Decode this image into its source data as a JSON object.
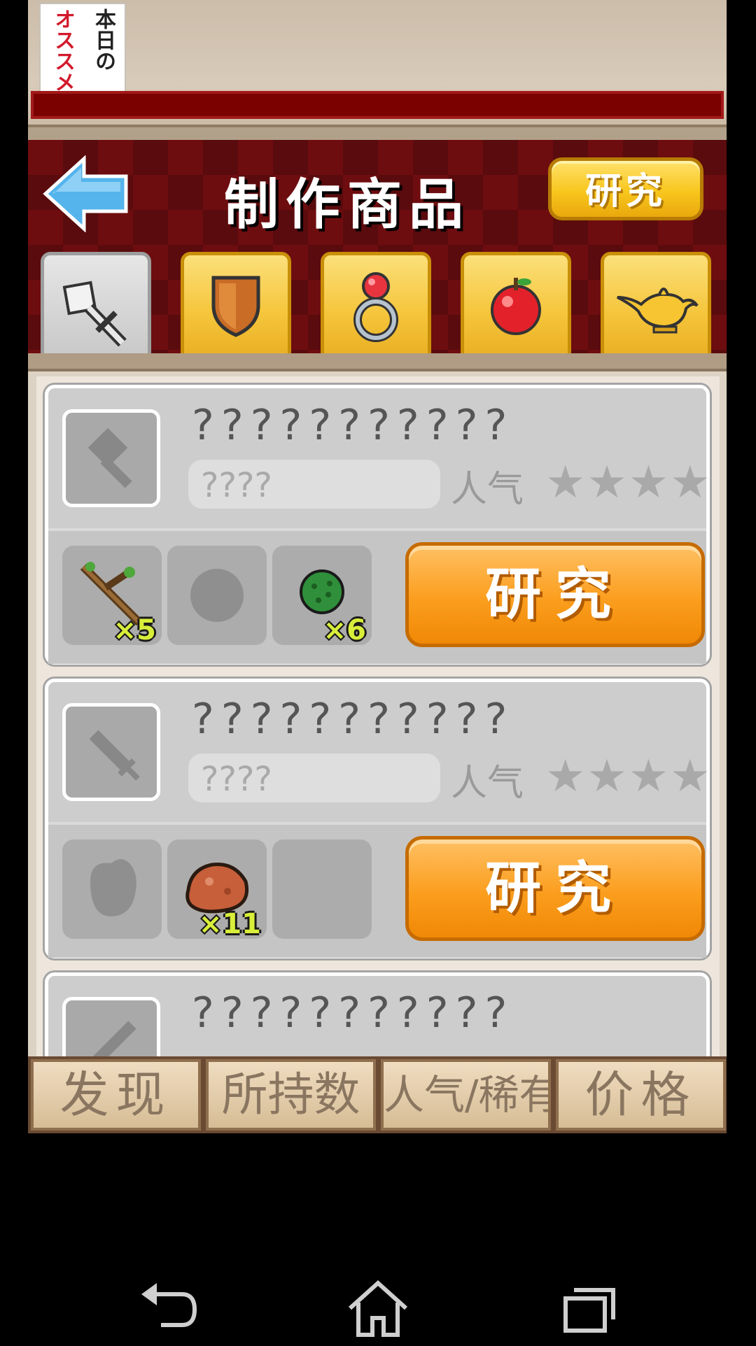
{
  "banner": {
    "logo_col1": "本日の",
    "logo_col2": "オススメ"
  },
  "header": {
    "title": "制作商品",
    "research_label": "研究"
  },
  "tabs": [
    {
      "name": "weapon",
      "icon": "sword-icon",
      "selected": true
    },
    {
      "name": "armor",
      "icon": "shield-icon",
      "selected": false
    },
    {
      "name": "accessory",
      "icon": "ring-icon",
      "selected": false
    },
    {
      "name": "food",
      "icon": "apple-icon",
      "selected": false
    },
    {
      "name": "magic",
      "icon": "magic-lamp-icon",
      "selected": false
    }
  ],
  "cards": [
    {
      "name": "???????????",
      "tag": "????",
      "popularity_label": "人气",
      "stars": "★★★★",
      "thumb_icon": "hammer-silhouette-icon",
      "materials": [
        {
          "icon": "branch-icon",
          "qty": "×5"
        },
        {
          "icon": "unknown-material-icon",
          "qty": ""
        },
        {
          "icon": "green-ball-icon",
          "qty": "×6"
        }
      ],
      "button_label": "研究"
    },
    {
      "name": "???????????",
      "tag": "????",
      "popularity_label": "人气",
      "stars": "★★★★",
      "thumb_icon": "sword-silhouette-icon",
      "materials": [
        {
          "icon": "unknown-material-icon",
          "qty": ""
        },
        {
          "icon": "ore-rock-icon",
          "qty": "×11"
        },
        {
          "icon": "empty-slot",
          "qty": ""
        }
      ],
      "button_label": "研究"
    },
    {
      "name": "???????????",
      "thumb_icon": "sword-silhouette-icon"
    }
  ],
  "sort_bar": [
    "发现",
    "所持数",
    "人气/稀有",
    "价格"
  ],
  "colors": {
    "header_red": "#6e0d10",
    "gold": "#f8c61d",
    "orange": "#fb9e1e",
    "card_gray": "#cdcdcd"
  }
}
